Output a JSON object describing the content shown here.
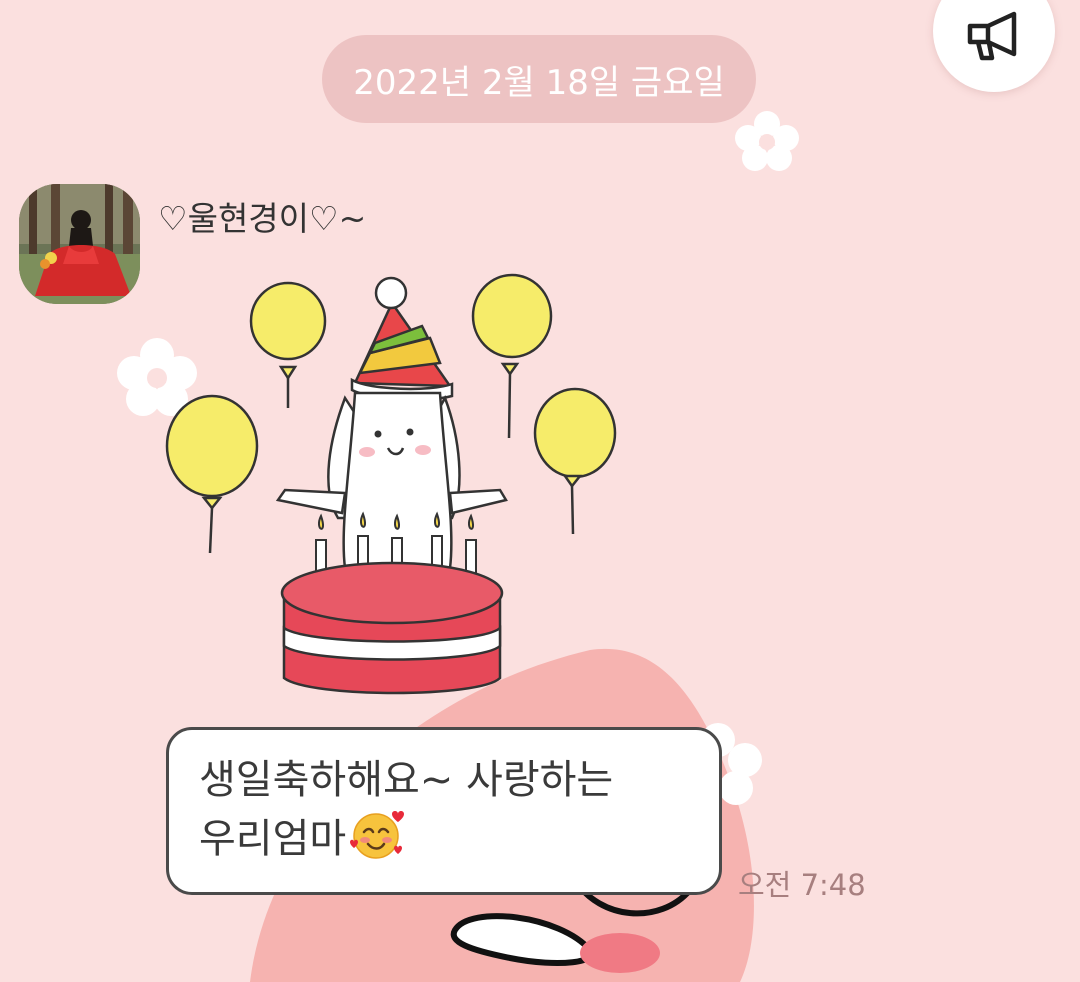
{
  "chat": {
    "date_divider": "2022년 2월 18일 금요일",
    "announce_icon": "megaphone-icon",
    "message": {
      "sender_name": "♡울현경이♡~",
      "avatar_icon": "profile-photo",
      "sticker_icon": "bunny-birthday-cake-sticker",
      "text_line1": "생일축하해요~ 사랑하는",
      "text_line2": "우리엄마",
      "emoji": "smiling-face-with-hearts",
      "time": "오전 7:48"
    }
  },
  "colors": {
    "background": "#fbe0df",
    "date_pill": "#edc3c3",
    "bubble_border": "#4a4a4a",
    "timestamp": "#a77f7f"
  }
}
